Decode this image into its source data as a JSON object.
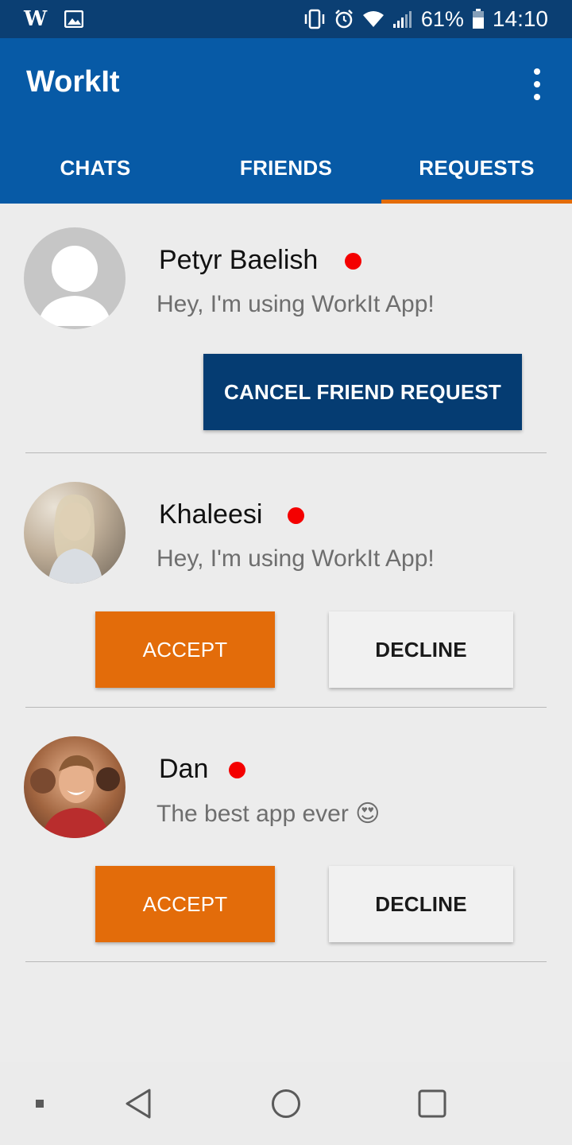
{
  "status_bar": {
    "app_icon_letter": "W",
    "battery_percent": "61%",
    "time": "14:10",
    "icons": [
      "w-app-icon",
      "image-icon",
      "vibrate-icon",
      "alarm-icon",
      "wifi-icon",
      "signal-icon",
      "battery-icon"
    ]
  },
  "app_bar": {
    "title": "WorkIt",
    "menu_icon": "overflow-menu-icon"
  },
  "tabs": [
    {
      "label": "CHATS",
      "active": false
    },
    {
      "label": "FRIENDS",
      "active": false
    },
    {
      "label": "REQUESTS",
      "active": true
    }
  ],
  "requests": [
    {
      "name": "Petyr Baelish",
      "status": "Hey, I'm using WorkIt App!",
      "online": true,
      "avatar": "default-avatar",
      "actions": {
        "cancel_label": "CANCEL FRIEND REQUEST"
      }
    },
    {
      "name": "Khaleesi",
      "status": "Hey, I'm using WorkIt App!",
      "online": true,
      "avatar": "photo-avatar",
      "actions": {
        "accept_label": "ACCEPT",
        "decline_label": "DECLINE"
      }
    },
    {
      "name": "Dan",
      "status": "The best app ever 😍",
      "online": true,
      "avatar": "photo-avatar",
      "actions": {
        "accept_label": "ACCEPT",
        "decline_label": "DECLINE"
      }
    }
  ],
  "colors": {
    "status_bar": "#0b3f73",
    "app_bar": "#075aa6",
    "tab_indicator": "#e36c0a",
    "accept": "#e36c0a",
    "cancel": "#053c72",
    "online_dot": "#f40000",
    "background": "#ececec"
  },
  "nav_bar": {
    "icons": [
      "dot-icon",
      "back-icon",
      "home-icon",
      "recents-icon"
    ]
  }
}
